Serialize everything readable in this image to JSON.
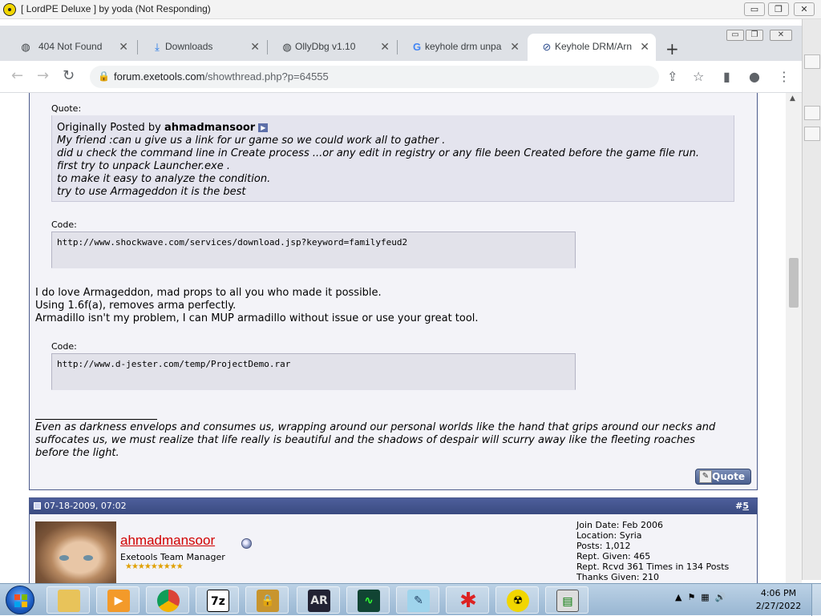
{
  "window": {
    "title": "[ LordPE Deluxe ] by yoda (Not Responding)",
    "minimize": "▭",
    "restore": "❐",
    "close": "✕"
  },
  "browser": {
    "tabs": [
      {
        "label": "404 Not Found",
        "icon": "globe-icon",
        "close": "✕"
      },
      {
        "label": "Downloads",
        "icon": "download-icon",
        "close": "✕"
      },
      {
        "label": "OllyDbg v1.10",
        "icon": "globe-icon",
        "close": "✕"
      },
      {
        "label": "keyhole drm unpa",
        "icon": "google-icon",
        "close": "✕"
      },
      {
        "label": "Keyhole DRM/Arn",
        "icon": "forum-icon",
        "close": "✕"
      }
    ],
    "new_tab": "+",
    "url_domain": "forum.exetools.com",
    "url_path": "/showthread.php?p=64555"
  },
  "post": {
    "quote_label": "Quote:",
    "originally_posted_by": "Originally Posted by",
    "quote_author": "ahmadmansoor",
    "quote_lines": [
      "My friend :can u give us a link for ur game so we could work all to gather .",
      "did u check the command line in Create process ...or any edit in registry or any file been Created before the game file run.",
      "first try to unpack Launcher.exe .",
      "to make it easy to analyze the condition.",
      "try to use Armageddon it is the best"
    ],
    "code_label_1": "Code:",
    "code_1": "http://www.shockwave.com/services/download.jsp?keyword=familyfeud2",
    "body_lines": [
      "I do love Armageddon, mad props to all you who made it possible.",
      "Using 1.6f(a), removes arma perfectly.",
      "Armadillo isn't my problem, I can MUP armadillo without issue or use your great tool."
    ],
    "code_label_2": "Code:",
    "code_2": "http://www.d-jester.com/temp/ProjectDemo.rar",
    "signature_lines": [
      "Even as darkness envelops and consumes us, wrapping around our personal worlds like the hand that grips around our necks and",
      "suffocates us, we must realize that life really is beautiful and the shadows of despair will scurry away like the fleeting roaches",
      "before the light."
    ],
    "quote_button": "Quote"
  },
  "post2": {
    "date": "07-18-2009, 07:02",
    "hash": "#",
    "number": "5",
    "username": "ahmadmansoor",
    "user_title": "Exetools Team Manager",
    "stars": "★★★★★★★★★",
    "stats": [
      "Join Date: Feb 2006",
      "Location: Syria",
      "Posts: 1,012",
      "Rept. Given: 465",
      "Rept. Rcvd 361 Times in 134 Posts",
      "Thanks Given: 210"
    ]
  },
  "taskbar": {
    "time": "4:06 PM",
    "date": "2/27/2022",
    "apps": [
      "explorer",
      "media-player",
      "chrome",
      "7zip",
      "lock",
      "ar",
      "monitor",
      "notepad",
      "asterisk",
      "lordpe",
      "terminal"
    ]
  },
  "colors": {
    "post_header": "#3f4f88",
    "username": "#d10000",
    "post_bg": "#f3f3f8"
  }
}
